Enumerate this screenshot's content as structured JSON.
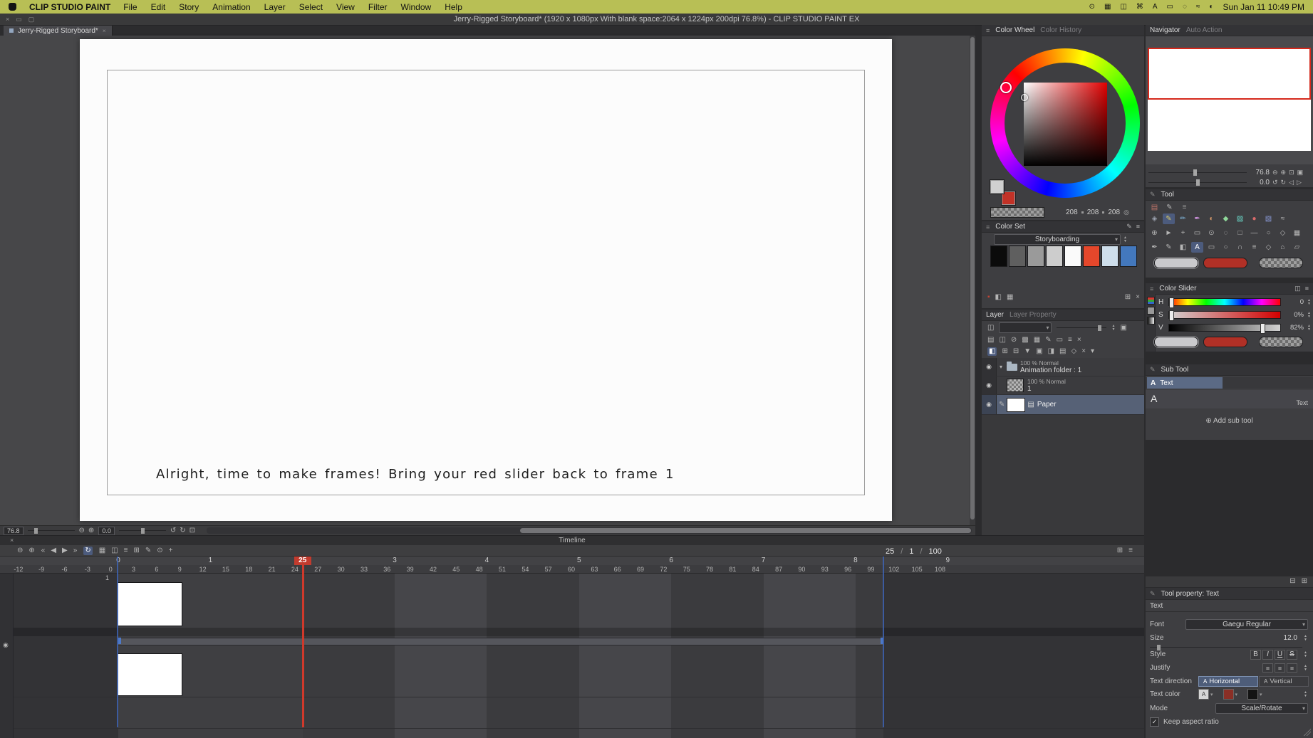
{
  "ui": {
    "a": "A",
    "up": "▴",
    "down": "▾",
    "check": "✓",
    "slash": "/"
  },
  "menubar": {
    "app_name": "CLIP STUDIO PAINT",
    "menus": [
      "File",
      "Edit",
      "Story",
      "Animation",
      "Layer",
      "Select",
      "View",
      "Filter",
      "Window",
      "Help"
    ],
    "status_icons": [
      {
        "name": "camera-icon",
        "g": "⊙"
      },
      {
        "name": "keyboard-icon",
        "g": "▦"
      },
      {
        "name": "display-icon",
        "g": "◫"
      },
      {
        "name": "command-icon",
        "g": "⌘"
      },
      {
        "name": "text-input-icon",
        "g": "A"
      },
      {
        "name": "battery-icon",
        "g": "▭"
      },
      {
        "name": "spotlight-icon",
        "g": "◌"
      },
      {
        "name": "wifi-icon",
        "g": "≈"
      },
      {
        "name": "control-center-icon",
        "g": "◐"
      }
    ],
    "clock": "Sun Jan 11 10:49 PM"
  },
  "titlebar": {
    "title": "Jerry-Rigged Storyboard* (1920 x 1080px With blank space:2064 x 1224px 200dpi 76.8%)  - CLIP STUDIO PAINT EX",
    "controls": [
      {
        "name": "close-window-icon",
        "g": "×"
      },
      {
        "name": "minimize-window-icon",
        "g": "▭"
      },
      {
        "name": "maximize-window-icon",
        "g": "▢"
      }
    ]
  },
  "document_tab": {
    "label": "Jerry-Rigged Storyboard*",
    "close": "×"
  },
  "canvas": {
    "caption": "Alright, time to make frames! Bring your red slider back to frame 1"
  },
  "canvas_statusbar": {
    "zoom_value": "76.8",
    "rotation_value": "0.0",
    "icons_zoom": [
      {
        "name": "zoom-out-icon",
        "g": "⊖"
      },
      {
        "name": "zoom-in-icon",
        "g": "⊕"
      }
    ],
    "icons_rotate": [
      {
        "name": "rotate-left-icon",
        "g": "↺"
      },
      {
        "name": "rotate-right-icon",
        "g": "↻"
      },
      {
        "name": "reset-view-icon",
        "g": "⊡"
      }
    ]
  },
  "timeline": {
    "title": "Timeline",
    "close": "×",
    "left_icons": [
      {
        "name": "timeline-zoom-out-icon",
        "g": "⊖"
      },
      {
        "name": "timeline-zoom-in-icon",
        "g": "⊕"
      }
    ],
    "transport": [
      {
        "name": "go-to-start-icon",
        "g": "«"
      },
      {
        "name": "prev-frame-icon",
        "g": "◀"
      },
      {
        "name": "play-icon",
        "g": "▶"
      },
      {
        "name": "go-to-end-icon",
        "g": "»"
      }
    ],
    "loop_icon": {
      "g": "↻"
    },
    "mid_icons": [
      {
        "name": "onion-skin-icon",
        "g": "▦"
      },
      {
        "name": "cel-display-icon",
        "g": "◫"
      },
      {
        "name": "track-menu-icon",
        "g": "≡"
      },
      {
        "name": "new-cel-icon",
        "g": "⊞"
      },
      {
        "name": "edit-cel-icon",
        "g": "✎"
      },
      {
        "name": "marker-icon",
        "g": "⊙"
      },
      {
        "name": "add-keyframe-icon",
        "g": "+"
      }
    ],
    "frame_display": {
      "current": "25",
      "sep1": "/",
      "start": "1",
      "sep2": "/",
      "end": "100"
    },
    "right_icons": [
      {
        "name": "timeline-settings-icon",
        "g": "⊞"
      },
      {
        "name": "timeline-menu-icon",
        "g": "≡"
      }
    ],
    "seconds": [
      {
        "s": 0,
        "label": "0"
      },
      {
        "s": 1,
        "label": "1"
      },
      {
        "s": 3,
        "label": "3"
      },
      {
        "s": 4,
        "label": "4"
      },
      {
        "s": 5,
        "label": "5"
      },
      {
        "s": 6,
        "label": "6"
      },
      {
        "s": 7,
        "label": "7"
      },
      {
        "s": 8,
        "label": "8"
      },
      {
        "s": 9,
        "label": "9"
      }
    ],
    "frame_start": -12,
    "frame_end": 109,
    "frame_step": 3,
    "current_frame": 25,
    "current_frame_badge": "25",
    "range_start_frame": 1,
    "range_end_frame": 100,
    "track1_label": "1"
  },
  "color_wheel": {
    "tab_active": "Color Wheel",
    "tab_inactive": "Color History",
    "rgb": {
      "r": "208",
      "g": "208",
      "b": "208"
    },
    "primary_color": "#d0d0d0",
    "secondary_color": "#c23227"
  },
  "color_set": {
    "title": "Color Set",
    "set_name": "Storyboarding",
    "header_icons": [
      {
        "name": "edit-color-set-icon",
        "g": "✎"
      },
      {
        "name": "color-set-menu-icon",
        "g": "≡"
      }
    ],
    "swatches": [
      {
        "bg": "#0b0b0b"
      },
      {
        "bg": "#5f5f5f"
      },
      {
        "bg": "#9a9a9a"
      },
      {
        "bg": "#cdcdcd"
      },
      {
        "bg": "#fafafa"
      },
      {
        "bg": "#e5472b"
      },
      {
        "bg": "#cedeeb"
      },
      {
        "bg": "#4378bd"
      }
    ],
    "footer_left": [
      {
        "name": "current-color-chip",
        "g": "▪",
        "c": "#c24434"
      },
      {
        "name": "mix-color-icon",
        "g": "◧"
      },
      {
        "name": "grid-view-icon",
        "g": "▦"
      }
    ],
    "footer_right": [
      {
        "name": "add-color-icon",
        "g": "⊞"
      },
      {
        "name": "delete-color-icon",
        "g": "×"
      }
    ]
  },
  "layer_panel": {
    "tab_active": "Layer",
    "tab_inactive": "Layer Property",
    "blend_icon": "◫",
    "row2_icons": [
      {
        "name": "palette-icon",
        "g": "▤"
      },
      {
        "name": "transfer-icon",
        "g": "◫"
      },
      {
        "name": "lock-layer-icon",
        "g": "⊘"
      },
      {
        "name": "lock-alpha-icon",
        "g": "▩"
      },
      {
        "name": "mask-icon",
        "g": "▦"
      },
      {
        "name": "draft-layer-icon",
        "g": "✎"
      },
      {
        "name": "frame-border-icon",
        "g": "▭"
      },
      {
        "name": "ruler-icon",
        "g": "≡"
      },
      {
        "name": "delete-icon",
        "g": "×"
      }
    ],
    "row3_icons": [
      {
        "name": "enable-timeline-icon",
        "g": "◧",
        "sel": true
      },
      {
        "name": "new-raster-layer-icon",
        "g": "⊞"
      },
      {
        "name": "new-folder-icon",
        "g": "⊟"
      },
      {
        "name": "transfer-down-icon",
        "g": "▼"
      },
      {
        "name": "merge-icon",
        "g": "▣"
      },
      {
        "name": "clipping-icon",
        "g": "◨"
      },
      {
        "name": "layer-settings-icon",
        "g": "▤"
      },
      {
        "name": "layer-mask-icon",
        "g": "◇"
      },
      {
        "name": "trash-icon",
        "g": "×"
      },
      {
        "name": "more-icon",
        "g": "▾"
      }
    ],
    "layers": [
      {
        "meta": "100 % Normal",
        "name": "Animation folder : 1"
      },
      {
        "meta": "100 % Normal",
        "name": "1"
      },
      {
        "name": "Paper"
      }
    ]
  },
  "navigator": {
    "tab_active": "Navigator",
    "tab_inactive": "Auto Action",
    "zoom_value": "76.8",
    "rotation_value": "0.0",
    "zoom_icons": [
      {
        "name": "nav-zoom-out-icon",
        "g": "⊖"
      },
      {
        "name": "nav-zoom-in-icon",
        "g": "⊕"
      },
      {
        "name": "fit-to-screen-icon",
        "g": "⊡"
      },
      {
        "name": "actual-size-icon",
        "g": "▣"
      }
    ],
    "rotate_icons": [
      {
        "name": "nav-rotate-left-icon",
        "g": "↺"
      },
      {
        "name": "nav-rotate-right-icon",
        "g": "↻"
      },
      {
        "name": "flip-horizontal-icon",
        "g": "◁"
      },
      {
        "name": "reset-rotation-icon",
        "g": "▷"
      }
    ]
  },
  "tool_panel": {
    "header_icon": "✎",
    "title": "Tool",
    "row0": [
      {
        "name": "favorites-icon",
        "g": "▤",
        "c": "#c0756a"
      },
      {
        "name": "brush-set-icon",
        "g": "✎",
        "c": "#b8b8b8"
      },
      {
        "name": "tool-menu-icon",
        "g": "≡",
        "c": "#999999"
      }
    ],
    "row1": [
      {
        "name": "operation-tool-icon",
        "g": "◈",
        "c": "#9aa0ad"
      },
      {
        "name": "pen-tool-icon",
        "g": "✎",
        "c": "#d8c96a",
        "sel": true
      },
      {
        "name": "pencil-tool-icon",
        "g": "✏",
        "c": "#7fb3d8"
      },
      {
        "name": "brush-tool-icon",
        "g": "✒",
        "c": "#c98fd8"
      },
      {
        "name": "airbrush-tool-icon",
        "g": "◐",
        "c": "#d89a6a"
      },
      {
        "name": "decoration-tool-icon",
        "g": "◆",
        "c": "#8fd89a"
      },
      {
        "name": "eraser-tool-icon",
        "g": "▨",
        "c": "#6ad8c9"
      },
      {
        "name": "blend-tool-icon",
        "g": "●",
        "c": "#d86a6a"
      },
      {
        "name": "fill-tool-icon",
        "g": "▧",
        "c": "#8a9ad8"
      },
      {
        "name": "gradient-tool-icon",
        "g": "≈",
        "c": "#b8b8b8"
      }
    ],
    "row2": [
      {
        "name": "zoom-tool-icon",
        "g": "⊕"
      },
      {
        "name": "move-tool-icon",
        "g": "►"
      },
      {
        "name": "select-tool-icon",
        "g": "+"
      },
      {
        "name": "marquee-tool-icon",
        "g": "▭"
      },
      {
        "name": "eyedropper-tool-icon",
        "g": "⊙"
      },
      {
        "name": "lasso-tool-icon",
        "g": "◌"
      },
      {
        "name": "frame-tool-icon",
        "g": "□"
      },
      {
        "name": "line-tool-icon",
        "g": "―"
      },
      {
        "name": "circle-tool-icon",
        "g": "○"
      },
      {
        "name": "polygon-tool-icon",
        "g": "◇"
      },
      {
        "name": "grid-tool-icon",
        "g": "▦"
      }
    ],
    "row3": [
      {
        "name": "ink-tool-icon",
        "g": "✒"
      },
      {
        "name": "correct-line-icon",
        "g": "✎"
      },
      {
        "name": "figure-tool-icon",
        "g": "◧"
      },
      {
        "name": "text-tool-icon",
        "g": "A",
        "sel": true
      },
      {
        "name": "balloon-tool-icon",
        "g": "▭"
      },
      {
        "name": "ellipse-tool-icon",
        "g": "○"
      },
      {
        "name": "curve-tool-icon",
        "g": "∩"
      },
      {
        "name": "ruler-tool-icon",
        "g": "≡"
      },
      {
        "name": "symmetry-tool-icon",
        "g": "◇"
      },
      {
        "name": "perspective-tool-icon",
        "g": "⌂"
      },
      {
        "name": "parallelogram-tool-icon",
        "g": "▱"
      }
    ],
    "main_color": "#c9c9cc",
    "sub_color": "#b13026"
  },
  "color_slider": {
    "title": "Color Slider",
    "header_icons": [
      {
        "name": "slider-expand-icon",
        "g": "◫"
      },
      {
        "name": "slider-menu-icon",
        "g": "≡"
      }
    ],
    "sliders": [
      {
        "label": "H",
        "value": "0",
        "pos": 0,
        "type": "hue"
      },
      {
        "label": "S",
        "value": "0%",
        "pos": 0,
        "type": "sat"
      },
      {
        "label": "V",
        "value": "82%",
        "pos": 0.82,
        "type": "val"
      }
    ]
  },
  "sub_tool": {
    "header_icon": "✎",
    "title": "Sub Tool",
    "item_icon": "A",
    "item_label": "Text",
    "tile_glyph": "A",
    "tile_label": "Text",
    "add_icon": "⊕",
    "add_label": "Add sub tool"
  },
  "panel_strip_icons": [
    {
      "name": "collapse-panel-icon",
      "g": "⊟"
    },
    {
      "name": "expand-panel-icon",
      "g": "⊞"
    }
  ],
  "tool_property": {
    "header_icon": "✎",
    "title": "Tool property: Text",
    "tool_name": "Text",
    "font_label": "Font",
    "font_value": "Gaegu Regular",
    "size_label": "Size",
    "size_value": "12.0",
    "style_label": "Style",
    "style_buttons": [
      "B",
      "I",
      "U",
      "S"
    ],
    "justify_label": "Justify",
    "justify_icons": [
      "≡",
      "≡",
      "≡"
    ],
    "direction_label": "Text direction",
    "horizontal_label": "Horizontal",
    "vertical_label": "Vertical",
    "color_label": "Text color",
    "color_swatches": [
      {
        "bg": "#d6d6d6",
        "glyph": "A"
      },
      {
        "bg": "#8a2f26",
        "glyph": ""
      },
      {
        "bg": "#141414",
        "glyph": ""
      }
    ],
    "mode_label": "Mode",
    "mode_value": "Scale/Rotate",
    "keep_aspect_label": "Keep aspect ratio"
  },
  "colors": {
    "menubar_bg": "#b8bf55",
    "playhead_red": "#d0392b",
    "range_blue": "#3e63b2",
    "selection_blue": "#4e5d79",
    "paper_white": "#fcfcfc"
  }
}
